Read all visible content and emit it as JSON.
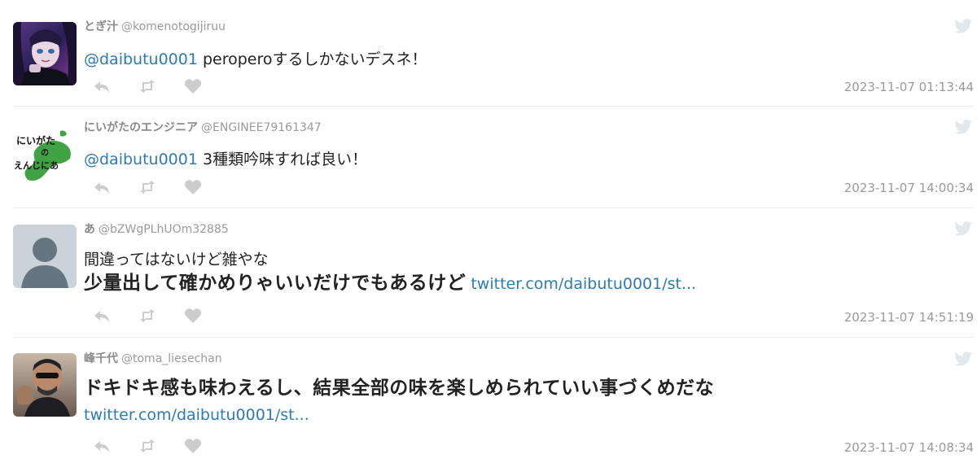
{
  "tweets": [
    {
      "display_name": "とぎ汁",
      "handle": "@komenotogijiruu",
      "mention": "@daibutu0001",
      "text": " peroperoするしかないデスネ！",
      "timestamp": "2023-11-07 01:13:44"
    },
    {
      "display_name": "にいがたのエンジニア",
      "handle": "@ENGINEE79161347",
      "mention": "@daibutu0001",
      "text": " 3種類吟味すれば良い！",
      "timestamp": "2023-11-07 14:00:34",
      "avatar_text": [
        "にいがた",
        "の",
        "えんじにあ"
      ]
    },
    {
      "display_name": "あ",
      "handle": "@bZWgPLhUOm32885",
      "text_line1": "間違ってはないけど雑やな",
      "text_bold": "少量出して確かめりゃいいだけでもあるけど",
      "link": "twitter.com/daibutu0001/st...",
      "timestamp": "2023-11-07 14:51:19"
    },
    {
      "display_name": "峰千代",
      "handle": "@toma_liesechan",
      "text_bold": "ドキドキ感も味わえるし、結果全部の味を楽しめられていい事づくめだな",
      "link": "twitter.com/daibutu0001/st...",
      "timestamp": "2023-11-07 14:08:34"
    }
  ],
  "icons": {
    "reply": "reply-icon",
    "retweet": "retweet-icon",
    "like": "heart-icon",
    "brand": "twitter-bird-icon"
  },
  "colors": {
    "link": "#2b7bb9",
    "meta": "#9a9a9a",
    "action_icon": "#cccccc",
    "divider": "#ebebeb"
  }
}
